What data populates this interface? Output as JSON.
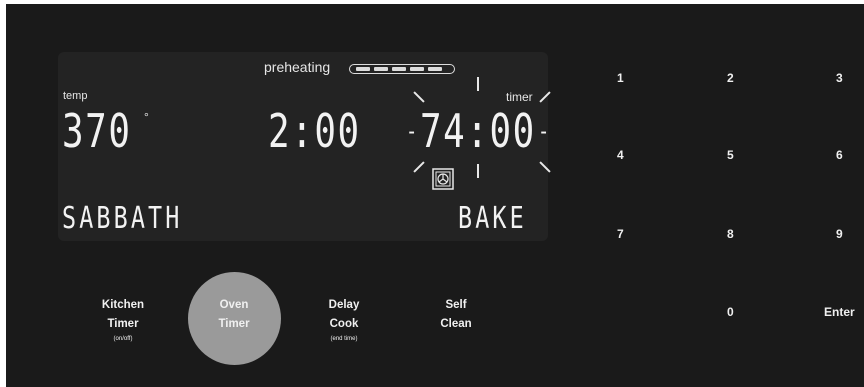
{
  "display": {
    "preheat_label": "preheating",
    "temp_label": "temp",
    "temp_value": "370",
    "degree": "°",
    "clock_value": "2:00",
    "timer_label": "timer",
    "timer_value": "74:00",
    "mode_left": "SABBATH",
    "mode_right": "BAKE",
    "oven_icon": "oven-fan-icon"
  },
  "keypad": {
    "k1": "1",
    "k2": "2",
    "k3": "3",
    "k4": "4",
    "k5": "5",
    "k6": "6",
    "k7": "7",
    "k8": "8",
    "k9": "9",
    "k0": "0",
    "enter": "Enter"
  },
  "buttons": {
    "kitchen_timer": {
      "line1": "Kitchen",
      "line2": "Timer",
      "sub": "(on/off)"
    },
    "oven_timer": {
      "line1": "Oven",
      "line2": "Timer"
    },
    "delay_cook": {
      "line1": "Delay",
      "line2": "Cook",
      "sub": "(end time)"
    },
    "self_clean": {
      "line1": "Self",
      "line2": "Clean"
    }
  },
  "colors": {
    "panel": "#1a1a1a",
    "lcd": "#232323",
    "active_button": "#9a9a9a"
  }
}
